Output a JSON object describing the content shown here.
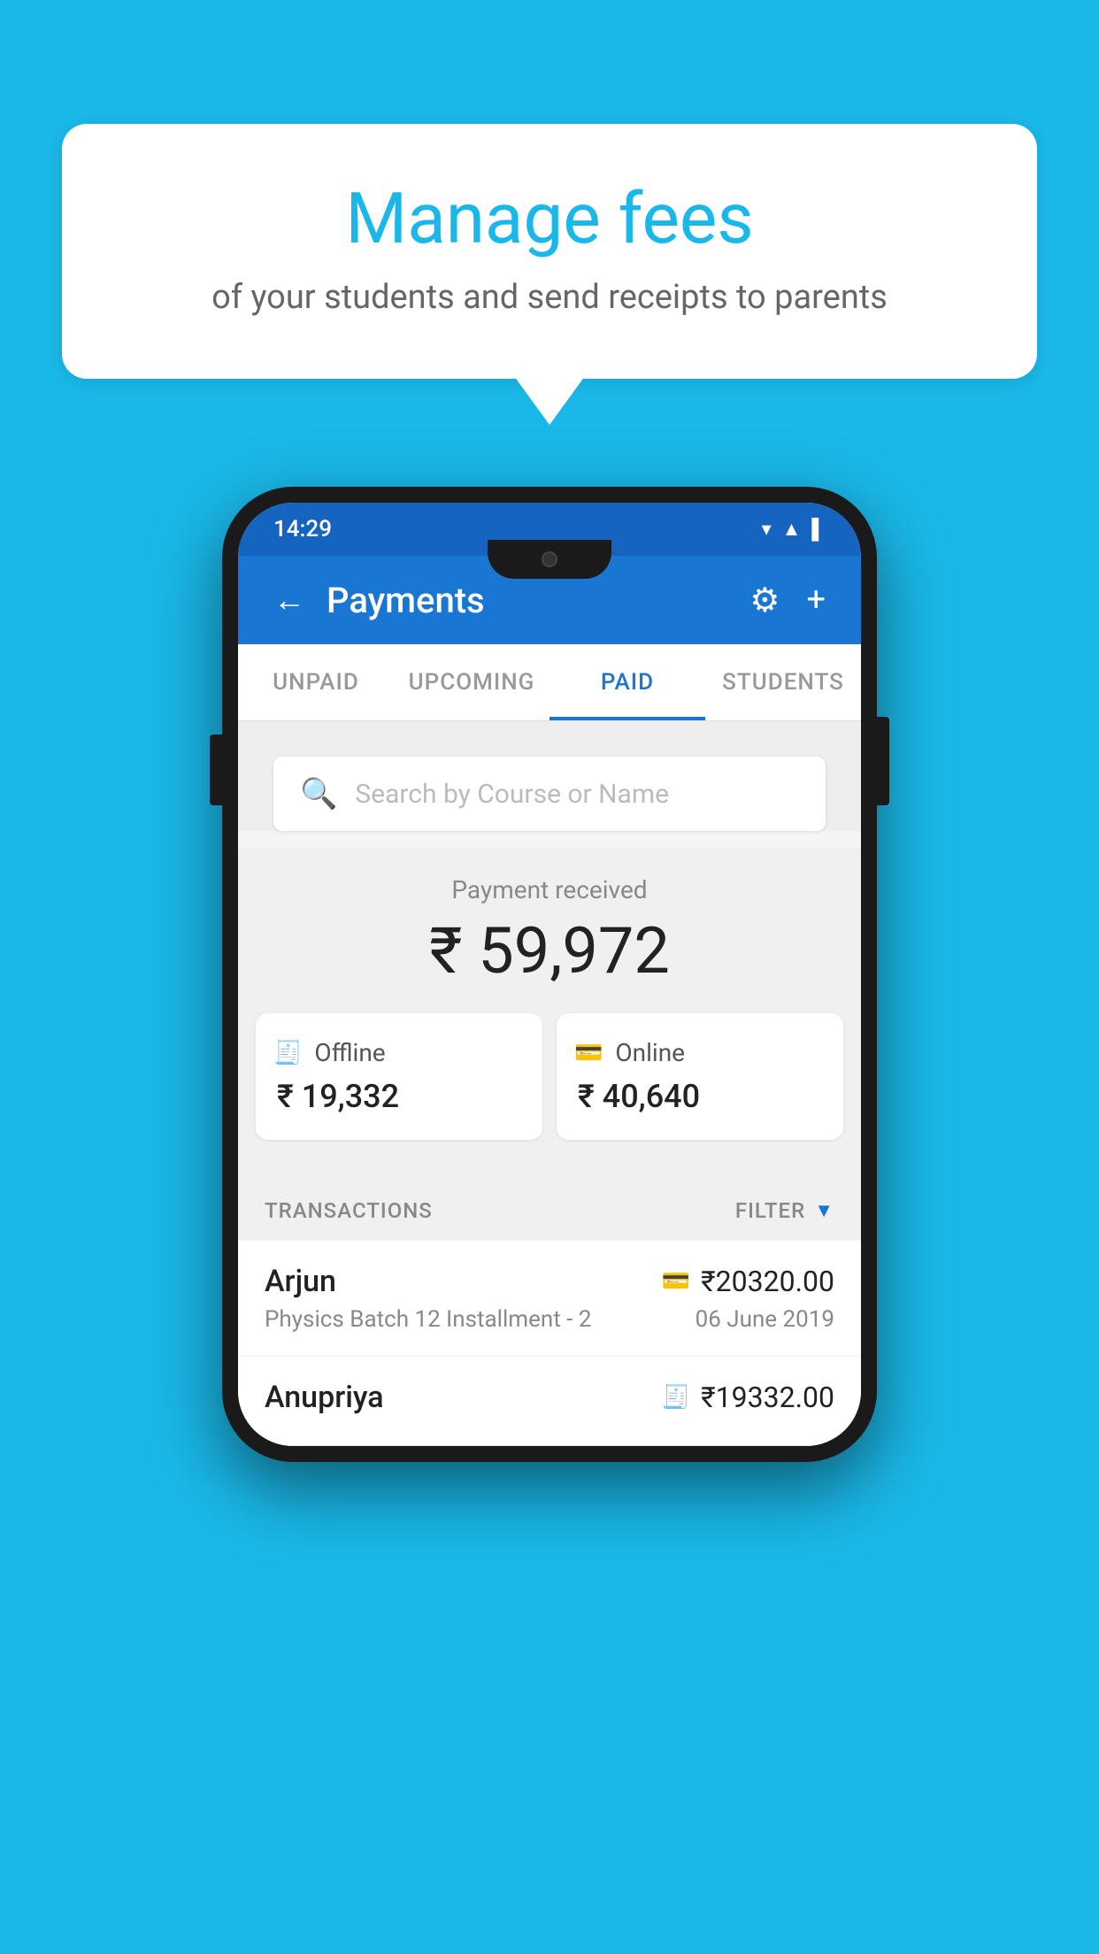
{
  "page": {
    "background_color": "#1ab8e8"
  },
  "speech_bubble": {
    "title": "Manage fees",
    "subtitle": "of your students and send receipts to parents"
  },
  "status_bar": {
    "time": "14:29",
    "icons": [
      "▼",
      "▲",
      "▌"
    ]
  },
  "header": {
    "title": "Payments",
    "back_label": "←",
    "gear_label": "⚙",
    "plus_label": "+"
  },
  "tabs": [
    {
      "label": "UNPAID",
      "active": false
    },
    {
      "label": "UPCOMING",
      "active": false
    },
    {
      "label": "PAID",
      "active": true
    },
    {
      "label": "STUDENTS",
      "active": false
    }
  ],
  "search": {
    "placeholder": "Search by Course or Name"
  },
  "payment_summary": {
    "label": "Payment received",
    "total": "₹ 59,972",
    "offline_label": "Offline",
    "offline_amount": "₹ 19,332",
    "online_label": "Online",
    "online_amount": "₹ 40,640"
  },
  "transactions_section": {
    "label": "TRANSACTIONS",
    "filter_label": "FILTER"
  },
  "transactions": [
    {
      "name": "Arjun",
      "amount": "₹20320.00",
      "payment_type": "online",
      "course": "Physics Batch 12 Installment - 2",
      "date": "06 June 2019"
    },
    {
      "name": "Anupriya",
      "amount": "₹19332.00",
      "payment_type": "offline",
      "course": "",
      "date": ""
    }
  ]
}
